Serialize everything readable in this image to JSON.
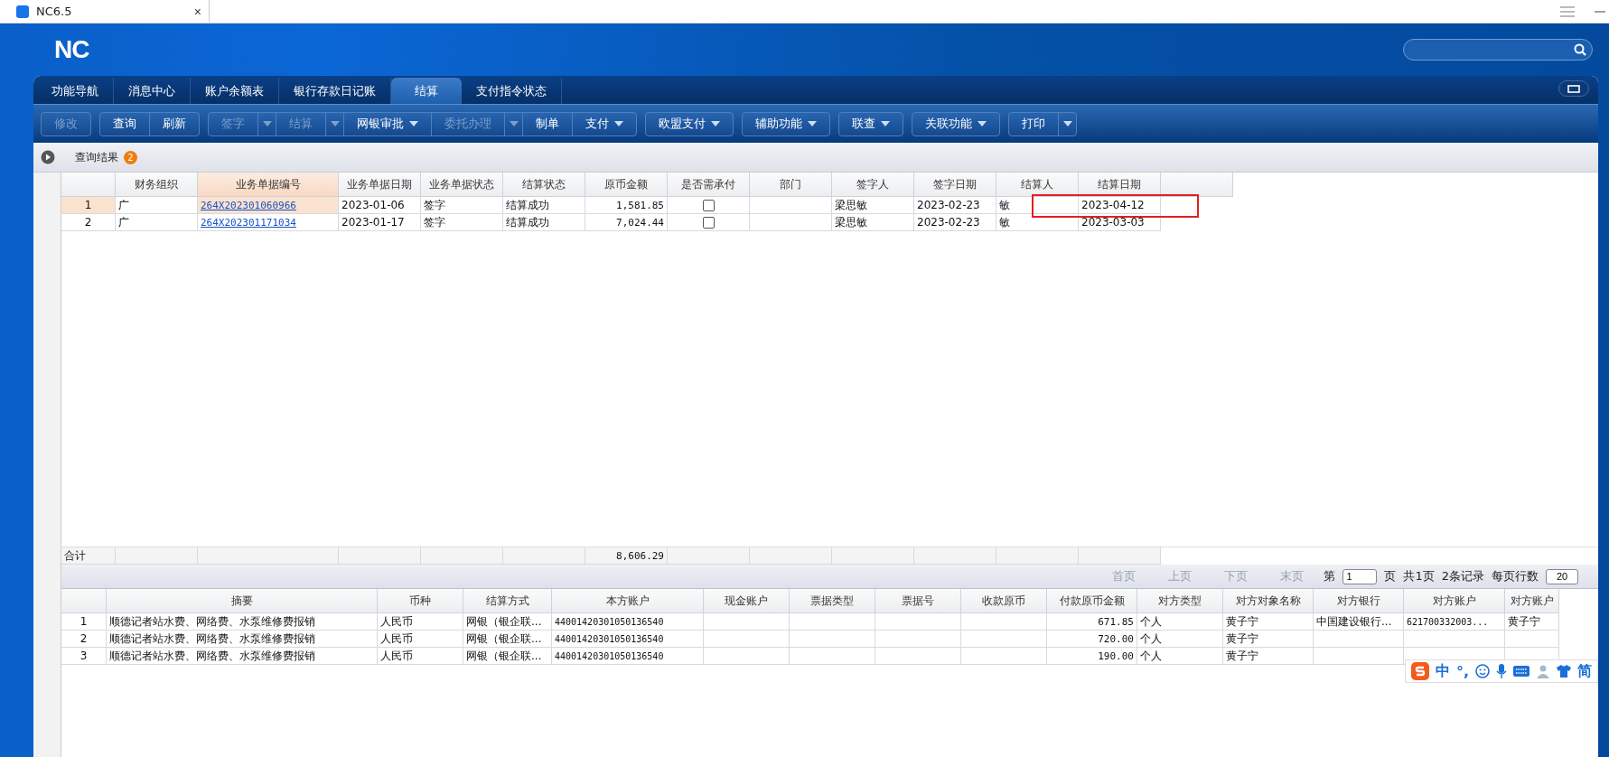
{
  "window": {
    "tab_title": "NC6.5",
    "close": "×"
  },
  "header": {
    "logo": "NC"
  },
  "nav_tabs": [
    {
      "label": "功能导航",
      "selected": false
    },
    {
      "label": "消息中心",
      "selected": false
    },
    {
      "label": "账户余额表",
      "selected": false
    },
    {
      "label": "银行存款日记账",
      "selected": false
    },
    {
      "label": "结算",
      "selected": true
    },
    {
      "label": "支付指令状态",
      "selected": false
    }
  ],
  "toolbar": [
    [
      {
        "label": "修改",
        "disabled": true,
        "kind": "plain"
      }
    ],
    [
      {
        "label": "查询",
        "disabled": false,
        "kind": "plain"
      },
      {
        "label": "刷新",
        "disabled": false,
        "kind": "plain"
      }
    ],
    [
      {
        "label": "签字",
        "disabled": true,
        "kind": "split"
      },
      {
        "label": "结算",
        "disabled": true,
        "kind": "split"
      },
      {
        "label": "网银审批",
        "disabled": false,
        "kind": "menu"
      },
      {
        "label": "委托办理",
        "disabled": true,
        "kind": "split"
      },
      {
        "label": "制单",
        "disabled": false,
        "kind": "plain"
      },
      {
        "label": "支付",
        "disabled": false,
        "kind": "menu"
      }
    ],
    [
      {
        "label": "欧盟支付",
        "disabled": false,
        "kind": "menu"
      }
    ],
    [
      {
        "label": "辅助功能",
        "disabled": false,
        "kind": "menu"
      }
    ],
    [
      {
        "label": "联查",
        "disabled": false,
        "kind": "menu"
      }
    ],
    [
      {
        "label": "关联功能",
        "disabled": false,
        "kind": "menu"
      }
    ],
    [
      {
        "label": "打印",
        "disabled": false,
        "kind": "split"
      }
    ]
  ],
  "result_bar": {
    "title": "查询结果",
    "count": "2"
  },
  "upper_table": {
    "highlight_box": true,
    "columns": [
      {
        "label": "财务组织",
        "kind": "text",
        "selected": false
      },
      {
        "label": "业务单据编号",
        "kind": "link",
        "selected": true
      },
      {
        "label": "业务单据日期",
        "kind": "text",
        "selected": false
      },
      {
        "label": "业务单据状态",
        "kind": "text",
        "selected": false
      },
      {
        "label": "结算状态",
        "kind": "text",
        "selected": false
      },
      {
        "label": "原币金额",
        "kind": "number",
        "selected": false
      },
      {
        "label": "是否需承付",
        "kind": "check",
        "selected": false
      },
      {
        "label": "部门",
        "kind": "text",
        "selected": false
      },
      {
        "label": "签字人",
        "kind": "text",
        "selected": false
      },
      {
        "label": "签字日期",
        "kind": "text",
        "selected": false
      },
      {
        "label": "结算人",
        "kind": "text",
        "selected": false
      },
      {
        "label": "结算日期",
        "kind": "text",
        "selected": false
      }
    ],
    "rows": [
      {
        "number": "1",
        "selected": true,
        "cells": [
          "广",
          "264X202301060966",
          "2023-01-06",
          "签字",
          "结算成功",
          "1,581.85",
          false,
          null,
          "梁思敏",
          "2023-02-23",
          "敏",
          "2023-04-12"
        ]
      },
      {
        "number": "2",
        "selected": false,
        "cells": [
          "广",
          "264X202301171034",
          "2023-01-17",
          "签字",
          "结算成功",
          "7,024.44",
          false,
          null,
          "梁思敏",
          "2023-02-23",
          "敏",
          "2023-03-03"
        ]
      }
    ],
    "totals": {
      "label": "合计",
      "cells": [
        null,
        null,
        null,
        null,
        null,
        "8,606.29",
        null,
        null,
        null,
        null,
        null,
        null
      ]
    }
  },
  "pager": {
    "first": "首页",
    "prev": "上页",
    "next": "下页",
    "last": "末页",
    "page_prefix": "第",
    "page": "1",
    "page_suffix": "页",
    "total_pages": "共1页",
    "records": "2条记录",
    "per_page_label": "每页行数",
    "per_page": "20"
  },
  "lower_table": {
    "columns": [
      {
        "label": "摘要",
        "kind": "text"
      },
      {
        "label": "币种",
        "kind": "text"
      },
      {
        "label": "结算方式",
        "kind": "text"
      },
      {
        "label": "本方账户",
        "kind": "code"
      },
      {
        "label": "现金账户",
        "kind": "text"
      },
      {
        "label": "票据类型",
        "kind": "text"
      },
      {
        "label": "票据号",
        "kind": "text"
      },
      {
        "label": "收款原币",
        "kind": "number"
      },
      {
        "label": "付款原币金额",
        "kind": "number"
      },
      {
        "label": "对方类型",
        "kind": "text"
      },
      {
        "label": "对方对象名称",
        "kind": "text"
      },
      {
        "label": "对方银行",
        "kind": "text"
      },
      {
        "label": "对方账户",
        "kind": "code"
      },
      {
        "label": "对方账户",
        "kind": "text"
      }
    ],
    "rows": [
      {
        "number": "1",
        "cells": [
          "顺德记者站水费、网络费、水泵维修费报销",
          "人民币",
          "网银（银企联...",
          "44001420301050136540",
          null,
          null,
          null,
          null,
          "671.85",
          "个人",
          "黄子宁",
          "中国建设银行...",
          "621700332003...",
          "黄子宁"
        ]
      },
      {
        "number": "2",
        "cells": [
          "顺德记者站水费、网络费、水泵维修费报销",
          "人民币",
          "网银（银企联...",
          "44001420301050136540",
          null,
          null,
          null,
          null,
          "720.00",
          "个人",
          "黄子宁",
          null,
          null,
          null
        ]
      },
      {
        "number": "3",
        "cells": [
          "顺德记者站水费、网络费、水泵维修费报销",
          "人民币",
          "网银（银企联...",
          "44001420301050136540",
          null,
          null,
          null,
          null,
          "190.00",
          "个人",
          "黄子宁",
          null,
          null,
          null
        ]
      }
    ]
  },
  "ime_toolbar": {
    "mode": "中",
    "punctuation": "°,",
    "script": "简"
  }
}
